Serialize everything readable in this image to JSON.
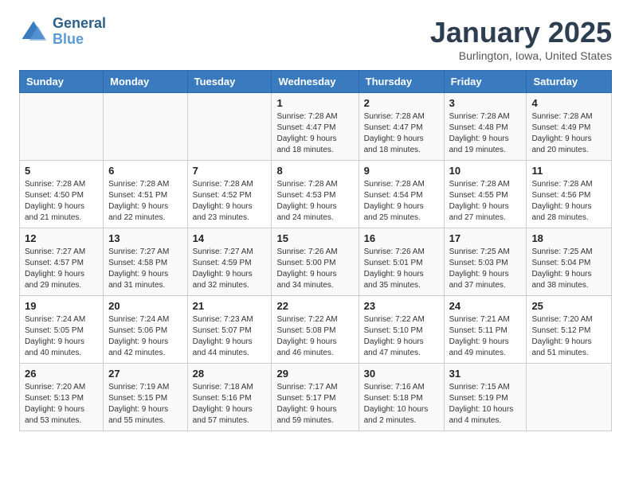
{
  "logo": {
    "general": "General",
    "blue": "Blue"
  },
  "header": {
    "month": "January 2025",
    "location": "Burlington, Iowa, United States"
  },
  "weekdays": [
    "Sunday",
    "Monday",
    "Tuesday",
    "Wednesday",
    "Thursday",
    "Friday",
    "Saturday"
  ],
  "weeks": [
    [
      {
        "day": "",
        "content": ""
      },
      {
        "day": "",
        "content": ""
      },
      {
        "day": "",
        "content": ""
      },
      {
        "day": "1",
        "content": "Sunrise: 7:28 AM\nSunset: 4:47 PM\nDaylight: 9 hours\nand 18 minutes."
      },
      {
        "day": "2",
        "content": "Sunrise: 7:28 AM\nSunset: 4:47 PM\nDaylight: 9 hours\nand 18 minutes."
      },
      {
        "day": "3",
        "content": "Sunrise: 7:28 AM\nSunset: 4:48 PM\nDaylight: 9 hours\nand 19 minutes."
      },
      {
        "day": "4",
        "content": "Sunrise: 7:28 AM\nSunset: 4:49 PM\nDaylight: 9 hours\nand 20 minutes."
      }
    ],
    [
      {
        "day": "5",
        "content": "Sunrise: 7:28 AM\nSunset: 4:50 PM\nDaylight: 9 hours\nand 21 minutes."
      },
      {
        "day": "6",
        "content": "Sunrise: 7:28 AM\nSunset: 4:51 PM\nDaylight: 9 hours\nand 22 minutes."
      },
      {
        "day": "7",
        "content": "Sunrise: 7:28 AM\nSunset: 4:52 PM\nDaylight: 9 hours\nand 23 minutes."
      },
      {
        "day": "8",
        "content": "Sunrise: 7:28 AM\nSunset: 4:53 PM\nDaylight: 9 hours\nand 24 minutes."
      },
      {
        "day": "9",
        "content": "Sunrise: 7:28 AM\nSunset: 4:54 PM\nDaylight: 9 hours\nand 25 minutes."
      },
      {
        "day": "10",
        "content": "Sunrise: 7:28 AM\nSunset: 4:55 PM\nDaylight: 9 hours\nand 27 minutes."
      },
      {
        "day": "11",
        "content": "Sunrise: 7:28 AM\nSunset: 4:56 PM\nDaylight: 9 hours\nand 28 minutes."
      }
    ],
    [
      {
        "day": "12",
        "content": "Sunrise: 7:27 AM\nSunset: 4:57 PM\nDaylight: 9 hours\nand 29 minutes."
      },
      {
        "day": "13",
        "content": "Sunrise: 7:27 AM\nSunset: 4:58 PM\nDaylight: 9 hours\nand 31 minutes."
      },
      {
        "day": "14",
        "content": "Sunrise: 7:27 AM\nSunset: 4:59 PM\nDaylight: 9 hours\nand 32 minutes."
      },
      {
        "day": "15",
        "content": "Sunrise: 7:26 AM\nSunset: 5:00 PM\nDaylight: 9 hours\nand 34 minutes."
      },
      {
        "day": "16",
        "content": "Sunrise: 7:26 AM\nSunset: 5:01 PM\nDaylight: 9 hours\nand 35 minutes."
      },
      {
        "day": "17",
        "content": "Sunrise: 7:25 AM\nSunset: 5:03 PM\nDaylight: 9 hours\nand 37 minutes."
      },
      {
        "day": "18",
        "content": "Sunrise: 7:25 AM\nSunset: 5:04 PM\nDaylight: 9 hours\nand 38 minutes."
      }
    ],
    [
      {
        "day": "19",
        "content": "Sunrise: 7:24 AM\nSunset: 5:05 PM\nDaylight: 9 hours\nand 40 minutes."
      },
      {
        "day": "20",
        "content": "Sunrise: 7:24 AM\nSunset: 5:06 PM\nDaylight: 9 hours\nand 42 minutes."
      },
      {
        "day": "21",
        "content": "Sunrise: 7:23 AM\nSunset: 5:07 PM\nDaylight: 9 hours\nand 44 minutes."
      },
      {
        "day": "22",
        "content": "Sunrise: 7:22 AM\nSunset: 5:08 PM\nDaylight: 9 hours\nand 46 minutes."
      },
      {
        "day": "23",
        "content": "Sunrise: 7:22 AM\nSunset: 5:10 PM\nDaylight: 9 hours\nand 47 minutes."
      },
      {
        "day": "24",
        "content": "Sunrise: 7:21 AM\nSunset: 5:11 PM\nDaylight: 9 hours\nand 49 minutes."
      },
      {
        "day": "25",
        "content": "Sunrise: 7:20 AM\nSunset: 5:12 PM\nDaylight: 9 hours\nand 51 minutes."
      }
    ],
    [
      {
        "day": "26",
        "content": "Sunrise: 7:20 AM\nSunset: 5:13 PM\nDaylight: 9 hours\nand 53 minutes."
      },
      {
        "day": "27",
        "content": "Sunrise: 7:19 AM\nSunset: 5:15 PM\nDaylight: 9 hours\nand 55 minutes."
      },
      {
        "day": "28",
        "content": "Sunrise: 7:18 AM\nSunset: 5:16 PM\nDaylight: 9 hours\nand 57 minutes."
      },
      {
        "day": "29",
        "content": "Sunrise: 7:17 AM\nSunset: 5:17 PM\nDaylight: 9 hours\nand 59 minutes."
      },
      {
        "day": "30",
        "content": "Sunrise: 7:16 AM\nSunset: 5:18 PM\nDaylight: 10 hours\nand 2 minutes."
      },
      {
        "day": "31",
        "content": "Sunrise: 7:15 AM\nSunset: 5:19 PM\nDaylight: 10 hours\nand 4 minutes."
      },
      {
        "day": "",
        "content": ""
      }
    ]
  ]
}
